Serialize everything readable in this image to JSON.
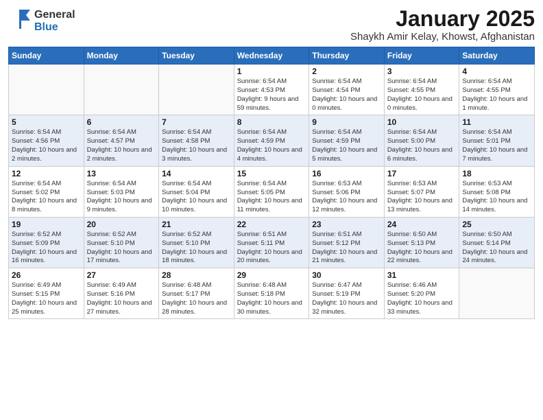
{
  "header": {
    "logo_general": "General",
    "logo_blue": "Blue",
    "title": "January 2025",
    "subtitle": "Shaykh Amir Kelay, Khowst, Afghanistan"
  },
  "weekdays": [
    "Sunday",
    "Monday",
    "Tuesday",
    "Wednesday",
    "Thursday",
    "Friday",
    "Saturday"
  ],
  "weeks": [
    {
      "row_index": 0,
      "cells": [
        {
          "day": "",
          "info": ""
        },
        {
          "day": "",
          "info": ""
        },
        {
          "day": "",
          "info": ""
        },
        {
          "day": "1",
          "info": "Sunrise: 6:54 AM\nSunset: 4:53 PM\nDaylight: 9 hours\nand 59 minutes."
        },
        {
          "day": "2",
          "info": "Sunrise: 6:54 AM\nSunset: 4:54 PM\nDaylight: 10 hours\nand 0 minutes."
        },
        {
          "day": "3",
          "info": "Sunrise: 6:54 AM\nSunset: 4:55 PM\nDaylight: 10 hours\nand 0 minutes."
        },
        {
          "day": "4",
          "info": "Sunrise: 6:54 AM\nSunset: 4:55 PM\nDaylight: 10 hours\nand 1 minute."
        }
      ]
    },
    {
      "row_index": 1,
      "cells": [
        {
          "day": "5",
          "info": "Sunrise: 6:54 AM\nSunset: 4:56 PM\nDaylight: 10 hours\nand 2 minutes."
        },
        {
          "day": "6",
          "info": "Sunrise: 6:54 AM\nSunset: 4:57 PM\nDaylight: 10 hours\nand 2 minutes."
        },
        {
          "day": "7",
          "info": "Sunrise: 6:54 AM\nSunset: 4:58 PM\nDaylight: 10 hours\nand 3 minutes."
        },
        {
          "day": "8",
          "info": "Sunrise: 6:54 AM\nSunset: 4:59 PM\nDaylight: 10 hours\nand 4 minutes."
        },
        {
          "day": "9",
          "info": "Sunrise: 6:54 AM\nSunset: 4:59 PM\nDaylight: 10 hours\nand 5 minutes."
        },
        {
          "day": "10",
          "info": "Sunrise: 6:54 AM\nSunset: 5:00 PM\nDaylight: 10 hours\nand 6 minutes."
        },
        {
          "day": "11",
          "info": "Sunrise: 6:54 AM\nSunset: 5:01 PM\nDaylight: 10 hours\nand 7 minutes."
        }
      ]
    },
    {
      "row_index": 2,
      "cells": [
        {
          "day": "12",
          "info": "Sunrise: 6:54 AM\nSunset: 5:02 PM\nDaylight: 10 hours\nand 8 minutes."
        },
        {
          "day": "13",
          "info": "Sunrise: 6:54 AM\nSunset: 5:03 PM\nDaylight: 10 hours\nand 9 minutes."
        },
        {
          "day": "14",
          "info": "Sunrise: 6:54 AM\nSunset: 5:04 PM\nDaylight: 10 hours\nand 10 minutes."
        },
        {
          "day": "15",
          "info": "Sunrise: 6:54 AM\nSunset: 5:05 PM\nDaylight: 10 hours\nand 11 minutes."
        },
        {
          "day": "16",
          "info": "Sunrise: 6:53 AM\nSunset: 5:06 PM\nDaylight: 10 hours\nand 12 minutes."
        },
        {
          "day": "17",
          "info": "Sunrise: 6:53 AM\nSunset: 5:07 PM\nDaylight: 10 hours\nand 13 minutes."
        },
        {
          "day": "18",
          "info": "Sunrise: 6:53 AM\nSunset: 5:08 PM\nDaylight: 10 hours\nand 14 minutes."
        }
      ]
    },
    {
      "row_index": 3,
      "cells": [
        {
          "day": "19",
          "info": "Sunrise: 6:52 AM\nSunset: 5:09 PM\nDaylight: 10 hours\nand 16 minutes."
        },
        {
          "day": "20",
          "info": "Sunrise: 6:52 AM\nSunset: 5:10 PM\nDaylight: 10 hours\nand 17 minutes."
        },
        {
          "day": "21",
          "info": "Sunrise: 6:52 AM\nSunset: 5:10 PM\nDaylight: 10 hours\nand 18 minutes."
        },
        {
          "day": "22",
          "info": "Sunrise: 6:51 AM\nSunset: 5:11 PM\nDaylight: 10 hours\nand 20 minutes."
        },
        {
          "day": "23",
          "info": "Sunrise: 6:51 AM\nSunset: 5:12 PM\nDaylight: 10 hours\nand 21 minutes."
        },
        {
          "day": "24",
          "info": "Sunrise: 6:50 AM\nSunset: 5:13 PM\nDaylight: 10 hours\nand 22 minutes."
        },
        {
          "day": "25",
          "info": "Sunrise: 6:50 AM\nSunset: 5:14 PM\nDaylight: 10 hours\nand 24 minutes."
        }
      ]
    },
    {
      "row_index": 4,
      "cells": [
        {
          "day": "26",
          "info": "Sunrise: 6:49 AM\nSunset: 5:15 PM\nDaylight: 10 hours\nand 25 minutes."
        },
        {
          "day": "27",
          "info": "Sunrise: 6:49 AM\nSunset: 5:16 PM\nDaylight: 10 hours\nand 27 minutes."
        },
        {
          "day": "28",
          "info": "Sunrise: 6:48 AM\nSunset: 5:17 PM\nDaylight: 10 hours\nand 28 minutes."
        },
        {
          "day": "29",
          "info": "Sunrise: 6:48 AM\nSunset: 5:18 PM\nDaylight: 10 hours\nand 30 minutes."
        },
        {
          "day": "30",
          "info": "Sunrise: 6:47 AM\nSunset: 5:19 PM\nDaylight: 10 hours\nand 32 minutes."
        },
        {
          "day": "31",
          "info": "Sunrise: 6:46 AM\nSunset: 5:20 PM\nDaylight: 10 hours\nand 33 minutes."
        },
        {
          "day": "",
          "info": ""
        }
      ]
    }
  ]
}
